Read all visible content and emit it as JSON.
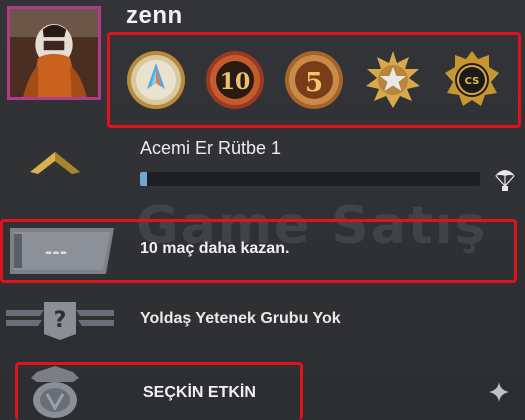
{
  "profile": {
    "username": "zenn"
  },
  "medals": [
    {
      "icon": "medal-10-year-veteran-icon"
    },
    {
      "icon": "medal-10-years-service-icon"
    },
    {
      "icon": "medal-5-years-service-icon"
    },
    {
      "icon": "medal-service-star-icon"
    },
    {
      "icon": "medal-csgo-operation-coin-icon"
    }
  ],
  "rank": {
    "name": "Acemi Er Rütbe 1",
    "progress_fraction": 0.02,
    "colors": {
      "chevron": "#d8b24a",
      "bar_fill": "#6fa6d6"
    }
  },
  "watermark": {
    "text": "Game Satış"
  },
  "competitive": {
    "status_text": "10 maç daha kazan.",
    "badge_text": "---"
  },
  "friends_skill_group": {
    "text": "Yoldaş Yetenek Grubu Yok",
    "badge_symbol": "?"
  },
  "elite": {
    "text": "SEÇKİN ETKİN"
  },
  "highlight_color": "#e0121a"
}
